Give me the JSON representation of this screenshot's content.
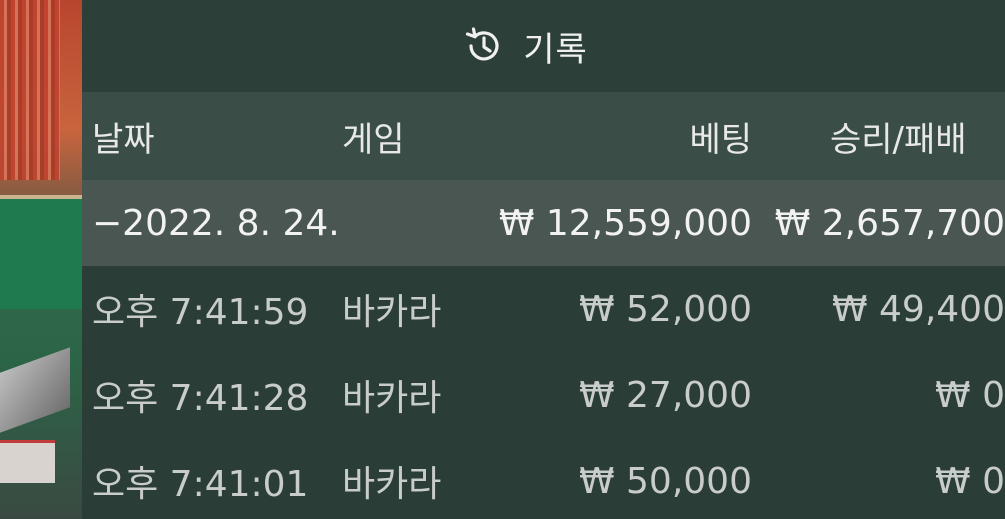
{
  "panel": {
    "title": "기록",
    "icon": "history-icon"
  },
  "columns": {
    "date": "날짜",
    "game": "게임",
    "bet": "베팅",
    "win_loss": "승리/패배"
  },
  "summary": {
    "date": "−2022. 8. 24.",
    "bet": "₩ 12,559,000",
    "win_loss": "₩ 2,657,700"
  },
  "rows": [
    {
      "time": "오후 7:41:59",
      "game": "바카라",
      "bet": "₩ 52,000",
      "win_loss": "₩ 49,400"
    },
    {
      "time": "오후 7:41:28",
      "game": "바카라",
      "bet": "₩ 27,000",
      "win_loss": "₩ 0"
    },
    {
      "time": "오후 7:41:01",
      "game": "바카라",
      "bet": "₩ 50,000",
      "win_loss": "₩ 0"
    }
  ]
}
